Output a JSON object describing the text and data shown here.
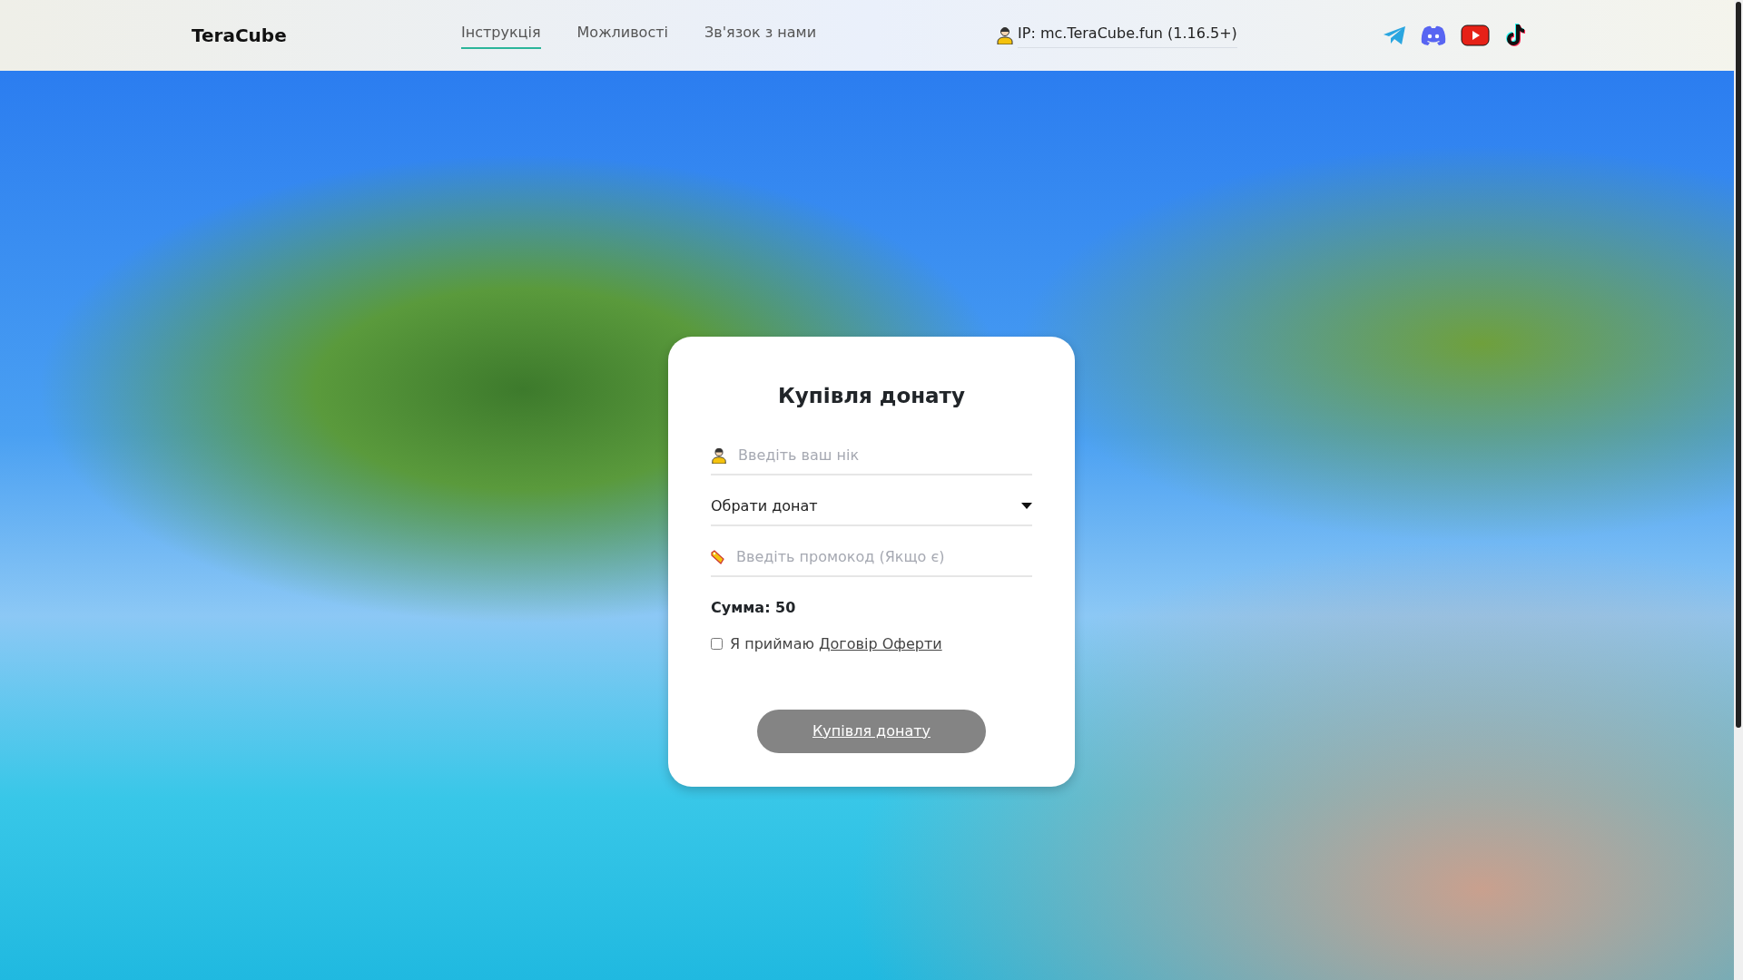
{
  "header": {
    "brand": "TeraCube",
    "nav": [
      {
        "label": "Інструкція",
        "selected": true
      },
      {
        "label": "Можливості",
        "selected": false
      },
      {
        "label": "Зв'язок з нами",
        "selected": false
      }
    ],
    "server_ip": "IP: mc.TeraCube.fun (1.16.5+)",
    "social": [
      {
        "kind": "telegram"
      },
      {
        "kind": "discord"
      },
      {
        "kind": "youtube"
      },
      {
        "kind": "tiktok"
      }
    ]
  },
  "form": {
    "title": "Купівля донату",
    "nick": {
      "placeholder": "Введіть ваш нік"
    },
    "donate_select": {
      "value": "Обрати донат"
    },
    "promo": {
      "placeholder": "Введіть промокод (Якщо є)"
    },
    "sum": "Сумма: 50",
    "agree": {
      "text": "Я приймаю",
      "link": "Договір Оферти",
      "checked": false
    },
    "submit": {
      "label": "Купівля донату",
      "disabled": true
    }
  }
}
